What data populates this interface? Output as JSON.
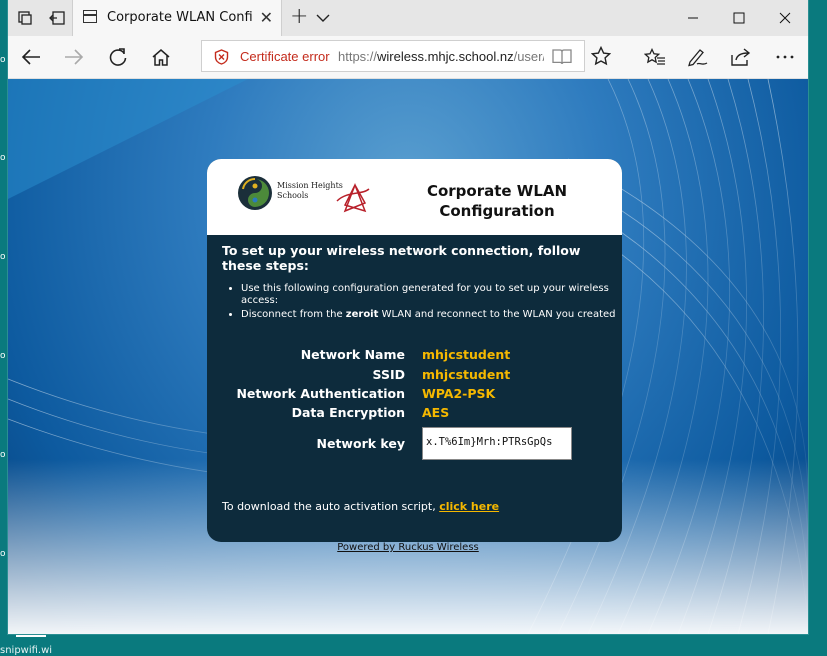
{
  "desktop": {
    "side_glyphs": [
      "o",
      "o",
      "o",
      "o",
      "o",
      "o"
    ],
    "bottom_label": "snipwifi.wi"
  },
  "browser": {
    "tab_title": "Corporate WLAN Config",
    "cert_label": "Certificate error",
    "url_prefix": "https://",
    "url_host": "wireless.mhjc.school.nz",
    "url_path": "/user/"
  },
  "page": {
    "logo_text_line1": "Mission Heights",
    "logo_text_line2": "Schools",
    "title_line1": "Corporate WLAN",
    "title_line2": "Configuration",
    "intro": "To set up your wireless network connection, follow these steps:",
    "steps": [
      "Use this following configuration generated for you to set up your wireless access:",
      "Disconnect from the zeroit WLAN and reconnect to the WLAN you created"
    ],
    "steps_zeroit_prefix": "Disconnect from the ",
    "steps_zeroit_bold": "zeroit",
    "steps_zeroit_suffix": " WLAN and reconnect to the WLAN you created",
    "fields": {
      "network_name_label": "Network Name",
      "network_name": "mhjcstudent",
      "ssid_label": "SSID",
      "ssid": "mhjcstudent",
      "auth_label": "Network Authentication",
      "auth": "WPA2-PSK",
      "enc_label": "Data Encryption",
      "enc": "AES",
      "key_label": "Network key",
      "key": "x.T%6Im}Mrh:PTRsGpQs"
    },
    "download_text": "To download the auto activation script, ",
    "download_link": "click here",
    "powered_by": "Powered by Ruckus Wireless"
  }
}
